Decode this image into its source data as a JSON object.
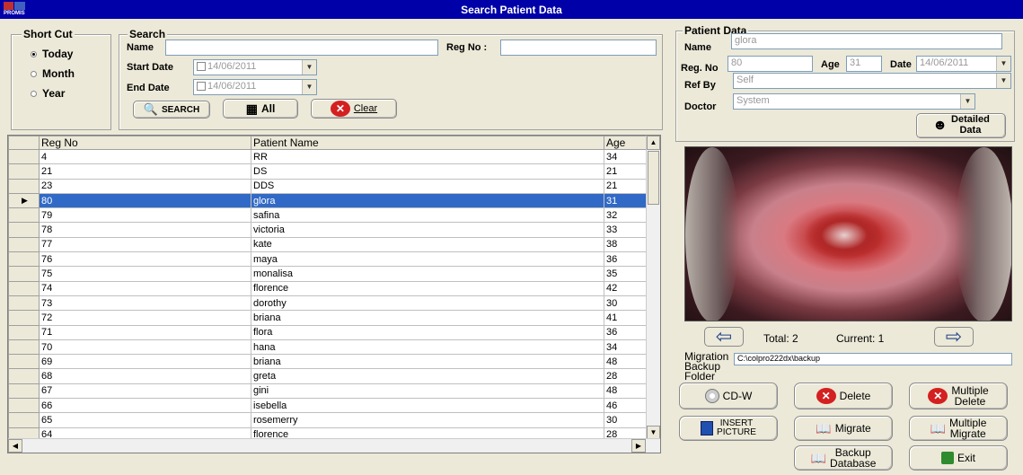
{
  "window": {
    "title": "Search Patient Data",
    "logo_text": "PROMIS"
  },
  "shortcut": {
    "label": "Short Cut",
    "options": [
      {
        "label": "Today",
        "selected": true
      },
      {
        "label": "Month",
        "selected": false
      },
      {
        "label": "Year",
        "selected": false
      }
    ]
  },
  "search": {
    "label": "Search",
    "name_label": "Name",
    "name_value": "",
    "regno_label": "Reg No :",
    "regno_value": "",
    "start_label": "Start Date",
    "start_value": "14/06/2011",
    "end_label": "End Date",
    "end_value": "14/06/2011",
    "search_btn": "SEARCH",
    "all_btn": "All",
    "clear_btn": "Clear"
  },
  "grid": {
    "columns": [
      "Reg No",
      "Patient Name",
      "Age"
    ],
    "selected_index": 3,
    "rows": [
      [
        "4",
        "RR",
        "34"
      ],
      [
        "21",
        "DS",
        "21"
      ],
      [
        "23",
        "DDS",
        "21"
      ],
      [
        "80",
        "glora",
        "31"
      ],
      [
        "79",
        "safina",
        "32"
      ],
      [
        "78",
        "victoria",
        "33"
      ],
      [
        "77",
        "kate",
        "38"
      ],
      [
        "76",
        "maya",
        "36"
      ],
      [
        "75",
        "monalisa",
        "35"
      ],
      [
        "74",
        "florence",
        "42"
      ],
      [
        "73",
        "dorothy",
        "30"
      ],
      [
        "72",
        "briana",
        "41"
      ],
      [
        "71",
        "flora",
        "36"
      ],
      [
        "70",
        "hana",
        "34"
      ],
      [
        "69",
        "briana",
        "48"
      ],
      [
        "68",
        "greta",
        "28"
      ],
      [
        "67",
        "gini",
        "48"
      ],
      [
        "66",
        "isebella",
        "46"
      ],
      [
        "65",
        "rosemerry",
        "30"
      ],
      [
        "64",
        "florence",
        "28"
      ]
    ]
  },
  "patient": {
    "label": "Patient Data",
    "name_label": "Name",
    "name_value": "glora",
    "regno_label": "Reg. No",
    "regno_value": "80",
    "age_label": "Age",
    "age_value": "31",
    "date_label": "Date",
    "date_value": "14/06/2011",
    "refby_label": "Ref By",
    "refby_value": "Self",
    "doctor_label": "Doctor",
    "doctor_value": "System",
    "detailed_btn_line1": "Detailed",
    "detailed_btn_line2": "Data"
  },
  "viewer": {
    "total_label": "Total: 2",
    "current_label": "Current: 1"
  },
  "migration": {
    "label_line1": "Migration",
    "label_line2": "Backup",
    "label_line3": "Folder",
    "path": "C:\\colpro222dx\\backup"
  },
  "actions": {
    "cdw": "CD-W",
    "delete": "Delete",
    "multi_delete_1": "Multiple",
    "multi_delete_2": "Delete",
    "insert_1": "INSERT",
    "insert_2": "PICTURE",
    "migrate": "Migrate",
    "multi_migrate_1": "Multiple",
    "multi_migrate_2": "Migrate",
    "backup_1": "Backup",
    "backup_2": "Database",
    "exit": "Exit"
  },
  "colors": {
    "title_bar": "#0000A8",
    "selection": "#3169C6",
    "delete_red": "#D42020"
  }
}
